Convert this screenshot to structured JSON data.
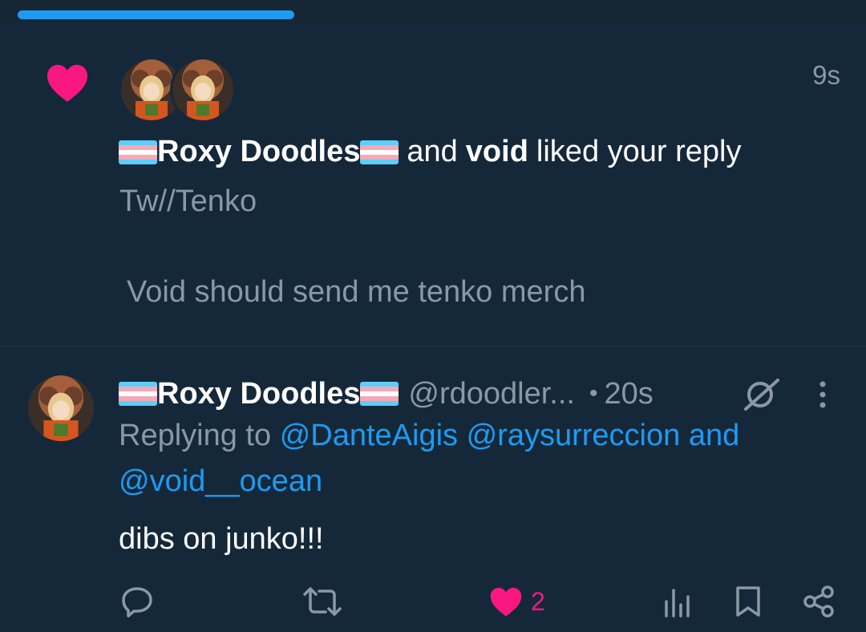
{
  "notification": {
    "time": "9s",
    "actor1": "Roxy Doodles",
    "connector": "and",
    "actor2": "void",
    "action": "liked your reply",
    "quoted_line1": "Tw//Tenko",
    "quoted_line2": "Void should send me tenko merch"
  },
  "tweet": {
    "display_name": "Roxy Doodles",
    "handle": "@rdoodler...",
    "dot": "•",
    "time": "20s",
    "replying_prefix": "Replying to",
    "mention1": "@DanteAigis",
    "mention2": "@raysurreccion",
    "mention_and": "and",
    "mention3": "@void__ocean",
    "text": "dibs on junko!!!",
    "like_count": "2"
  },
  "icons": {
    "notification_type": "heart-icon",
    "reply": "reply-icon",
    "retweet": "retweet-icon",
    "like": "heart-icon",
    "views": "views-icon",
    "bookmark": "bookmark-icon",
    "share": "share-icon",
    "grok": "grok-icon",
    "more": "more-vertical-icon"
  },
  "colors": {
    "background": "#15283a",
    "accent": "#1d9bf0",
    "like": "#f91880",
    "muted": "#8b98a5"
  }
}
